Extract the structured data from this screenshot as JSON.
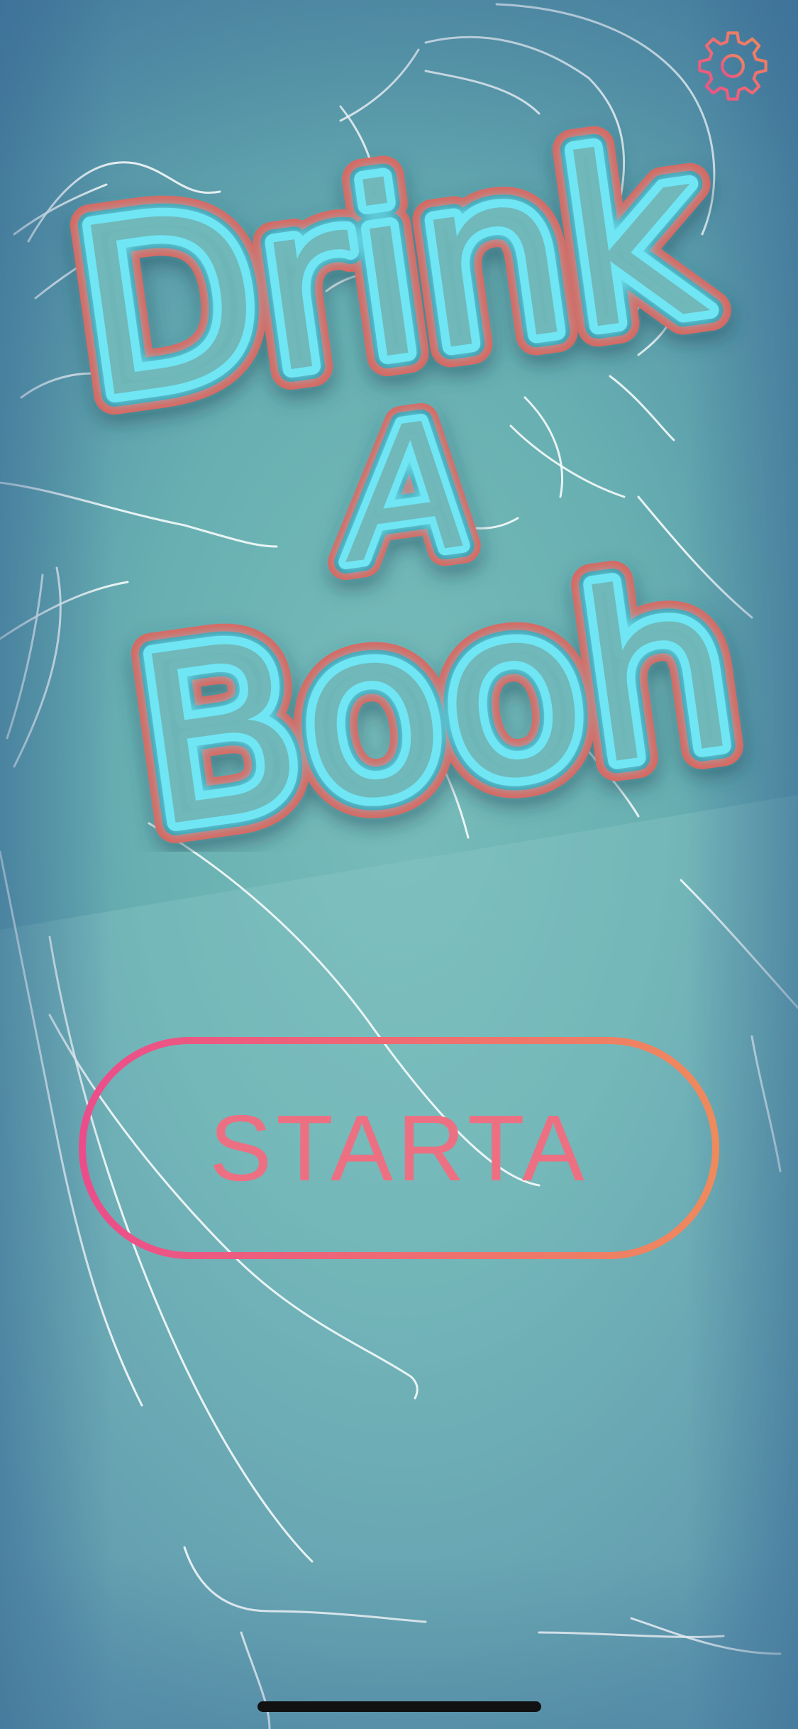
{
  "app": {
    "logo_line1": "Drink",
    "logo_line2": "A",
    "logo_line3": "Booh"
  },
  "start_button": {
    "label": "STARTA"
  },
  "icons": {
    "settings": "gear-icon"
  },
  "colors": {
    "background": "#6fb3b3",
    "neon_tube": "#6fe6f4",
    "neon_outline": "#d9665f",
    "button_gradient_start": "#ec4d8a",
    "button_gradient_end": "#ef8a5c",
    "button_text": "#ec7082",
    "sketch_lines": "#ffffff"
  }
}
